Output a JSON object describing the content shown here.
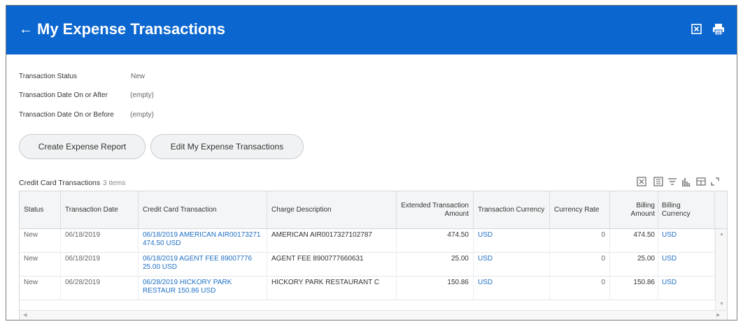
{
  "header": {
    "title": "My Expense Transactions",
    "back_icon": "←"
  },
  "filters": [
    {
      "label": "Transaction Status",
      "value": "New"
    },
    {
      "label": "Transaction Date On or After",
      "value": "(empty)"
    },
    {
      "label": "Transaction Date On or Before",
      "value": "(empty)"
    }
  ],
  "buttons": {
    "create": "Create Expense Report",
    "edit": "Edit My Expense Transactions"
  },
  "grid": {
    "title": "Credit Card Transactions",
    "count": "3 items",
    "columns": [
      "Status",
      "Transaction Date",
      "Credit Card Transaction",
      "Charge Description",
      "Extended Transaction Amount",
      "Transaction Currency",
      "Currency Rate",
      "Billing Amount",
      "Billing Currency"
    ],
    "rows": [
      {
        "status": "New",
        "date": "06/18/2019",
        "transaction": "06/18/2019 AMERICAN AIR00173271 474.50 USD",
        "description": "AMERICAN AIR0017327102787",
        "extended_amount": "474.50",
        "currency": "USD",
        "rate": "0",
        "billing_amount": "474.50",
        "billing_currency": "USD"
      },
      {
        "status": "New",
        "date": "06/18/2019",
        "transaction": "06/18/2019 AGENT FEE 89007776 25.00 USD",
        "description": "AGENT FEE  8900777660631",
        "extended_amount": "25.00",
        "currency": "USD",
        "rate": "0",
        "billing_amount": "25.00",
        "billing_currency": "USD"
      },
      {
        "status": "New",
        "date": "06/28/2019",
        "transaction": "06/28/2019 HICKORY PARK RESTAUR 150.86 USD",
        "description": "HICKORY PARK RESTAURANT C",
        "extended_amount": "150.86",
        "currency": "USD",
        "rate": "0",
        "billing_amount": "150.86",
        "billing_currency": "USD"
      }
    ]
  },
  "colors": {
    "header_bg": "#0b66cf",
    "link": "#1f6fc5"
  },
  "icons": {
    "header": [
      "excel-export-icon",
      "print-icon"
    ],
    "toolbar": [
      "excel-export-icon",
      "column-chooser-icon",
      "filter-icon",
      "chart-icon",
      "table-view-icon",
      "expand-icon"
    ]
  }
}
